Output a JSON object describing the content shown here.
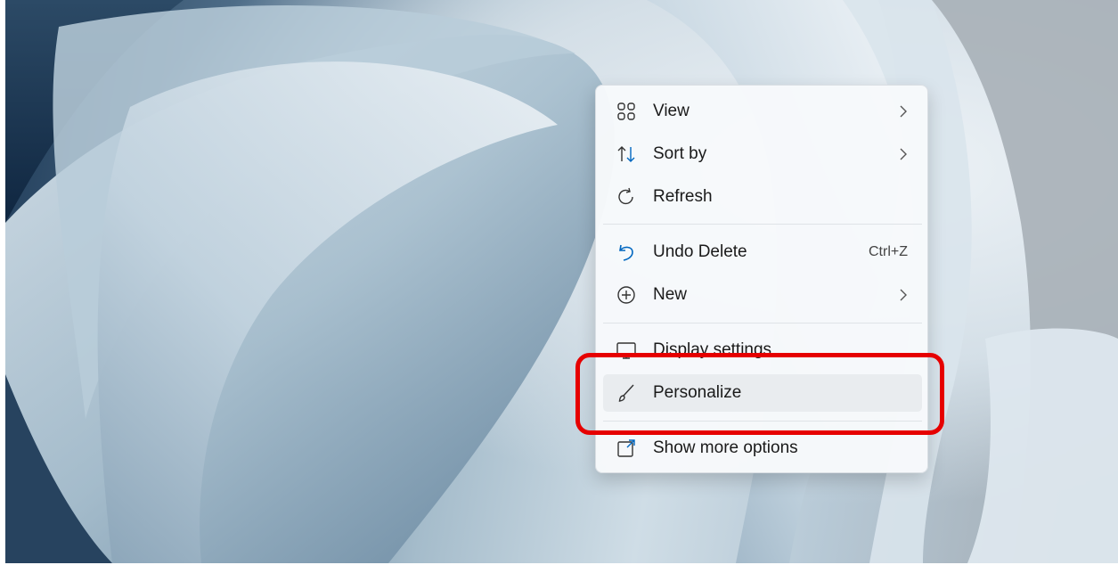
{
  "context_menu": {
    "items": [
      {
        "label": "View",
        "icon": "grid-view-icon",
        "has_submenu": true
      },
      {
        "label": "Sort by",
        "icon": "sort-arrows-icon",
        "has_submenu": true
      },
      {
        "label": "Refresh",
        "icon": "refresh-icon",
        "has_submenu": false
      },
      {
        "label": "Undo Delete",
        "icon": "undo-icon",
        "accelerator": "Ctrl+Z"
      },
      {
        "label": "New",
        "icon": "plus-circle-icon",
        "has_submenu": true
      },
      {
        "label": "Display settings",
        "icon": "display-icon",
        "has_submenu": false
      },
      {
        "label": "Personalize",
        "icon": "brush-icon",
        "has_submenu": false,
        "hovered": true
      },
      {
        "label": "Show more options",
        "icon": "expand-icon",
        "has_submenu": false
      }
    ]
  },
  "annotation": {
    "target": "Personalize",
    "color": "#e60000"
  },
  "colors": {
    "accent": "#0067c0",
    "menu_bg": "#f7f9fb",
    "hover_bg": "#e9ecef"
  }
}
